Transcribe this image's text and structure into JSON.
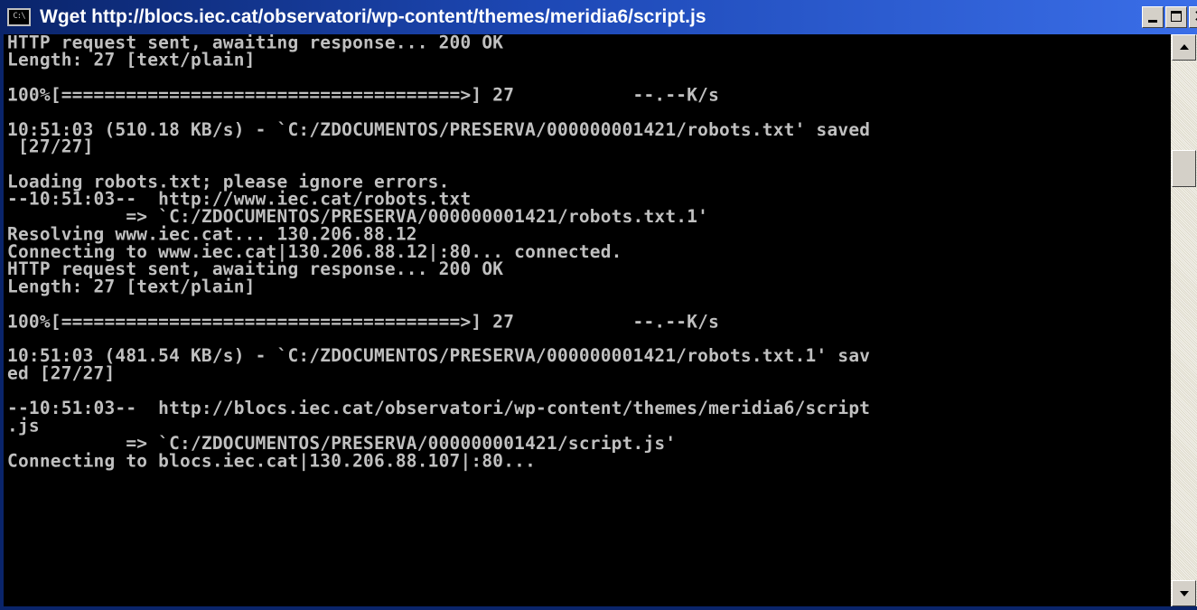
{
  "window": {
    "title": "Wget http://blocs.iec.cat/observatori/wp-content/themes/meridia6/script.js",
    "icon": "console-icon",
    "icon_text": "C:\\"
  },
  "console": {
    "lines": [
      "HTTP request sent, awaiting response... 200 OK",
      "Length: 27 [text/plain]",
      "",
      "100%[=====================================>] 27           --.--K/s",
      "",
      "10:51:03 (510.18 KB/s) - `C:/ZDOCUMENTOS/PRESERVA/000000001421/robots.txt' saved",
      " [27/27]",
      "",
      "Loading robots.txt; please ignore errors.",
      "--10:51:03--  http://www.iec.cat/robots.txt",
      "           => `C:/ZDOCUMENTOS/PRESERVA/000000001421/robots.txt.1'",
      "Resolving www.iec.cat... 130.206.88.12",
      "Connecting to www.iec.cat|130.206.88.12|:80... connected.",
      "HTTP request sent, awaiting response... 200 OK",
      "Length: 27 [text/plain]",
      "",
      "100%[=====================================>] 27           --.--K/s",
      "",
      "10:51:03 (481.54 KB/s) - `C:/ZDOCUMENTOS/PRESERVA/000000001421/robots.txt.1' sav",
      "ed [27/27]",
      "",
      "--10:51:03--  http://blocs.iec.cat/observatori/wp-content/themes/meridia6/script",
      ".js",
      "           => `C:/ZDOCUMENTOS/PRESERVA/000000001421/script.js'",
      "Connecting to blocs.iec.cat|130.206.88.107|:80..."
    ]
  },
  "colors": {
    "console_bg": "#000000",
    "console_fg": "#c0c0c0",
    "titlebar": "#0a246a"
  }
}
